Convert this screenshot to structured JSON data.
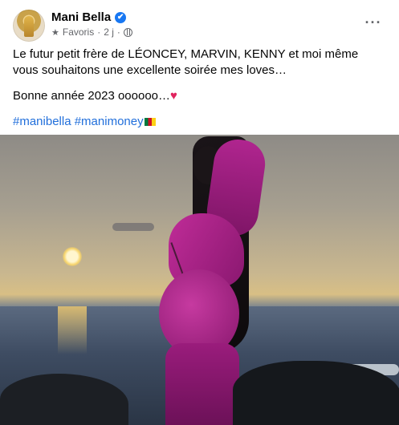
{
  "author": {
    "name": "Mani Bella",
    "verified_mark": "✔",
    "favorites_label": "Favoris",
    "time": "2 j",
    "separator": "·"
  },
  "post": {
    "line1": "Le futur petit frère de LÉONCEY, MARVIN, KENNY et moi même vous souhaitons une excellente soirée mes loves…",
    "line2": "Bonne année 2023 oooooo…",
    "heart": "♥",
    "hashtags": "#manibella #manimoney"
  },
  "icons": {
    "more": "more-options-icon",
    "star": "star-icon",
    "globe": "globe-icon",
    "flag": "cameroon-flag-icon"
  },
  "colors": {
    "link": "#216fdb",
    "verified": "#1877f2",
    "meta": "#65676b"
  }
}
